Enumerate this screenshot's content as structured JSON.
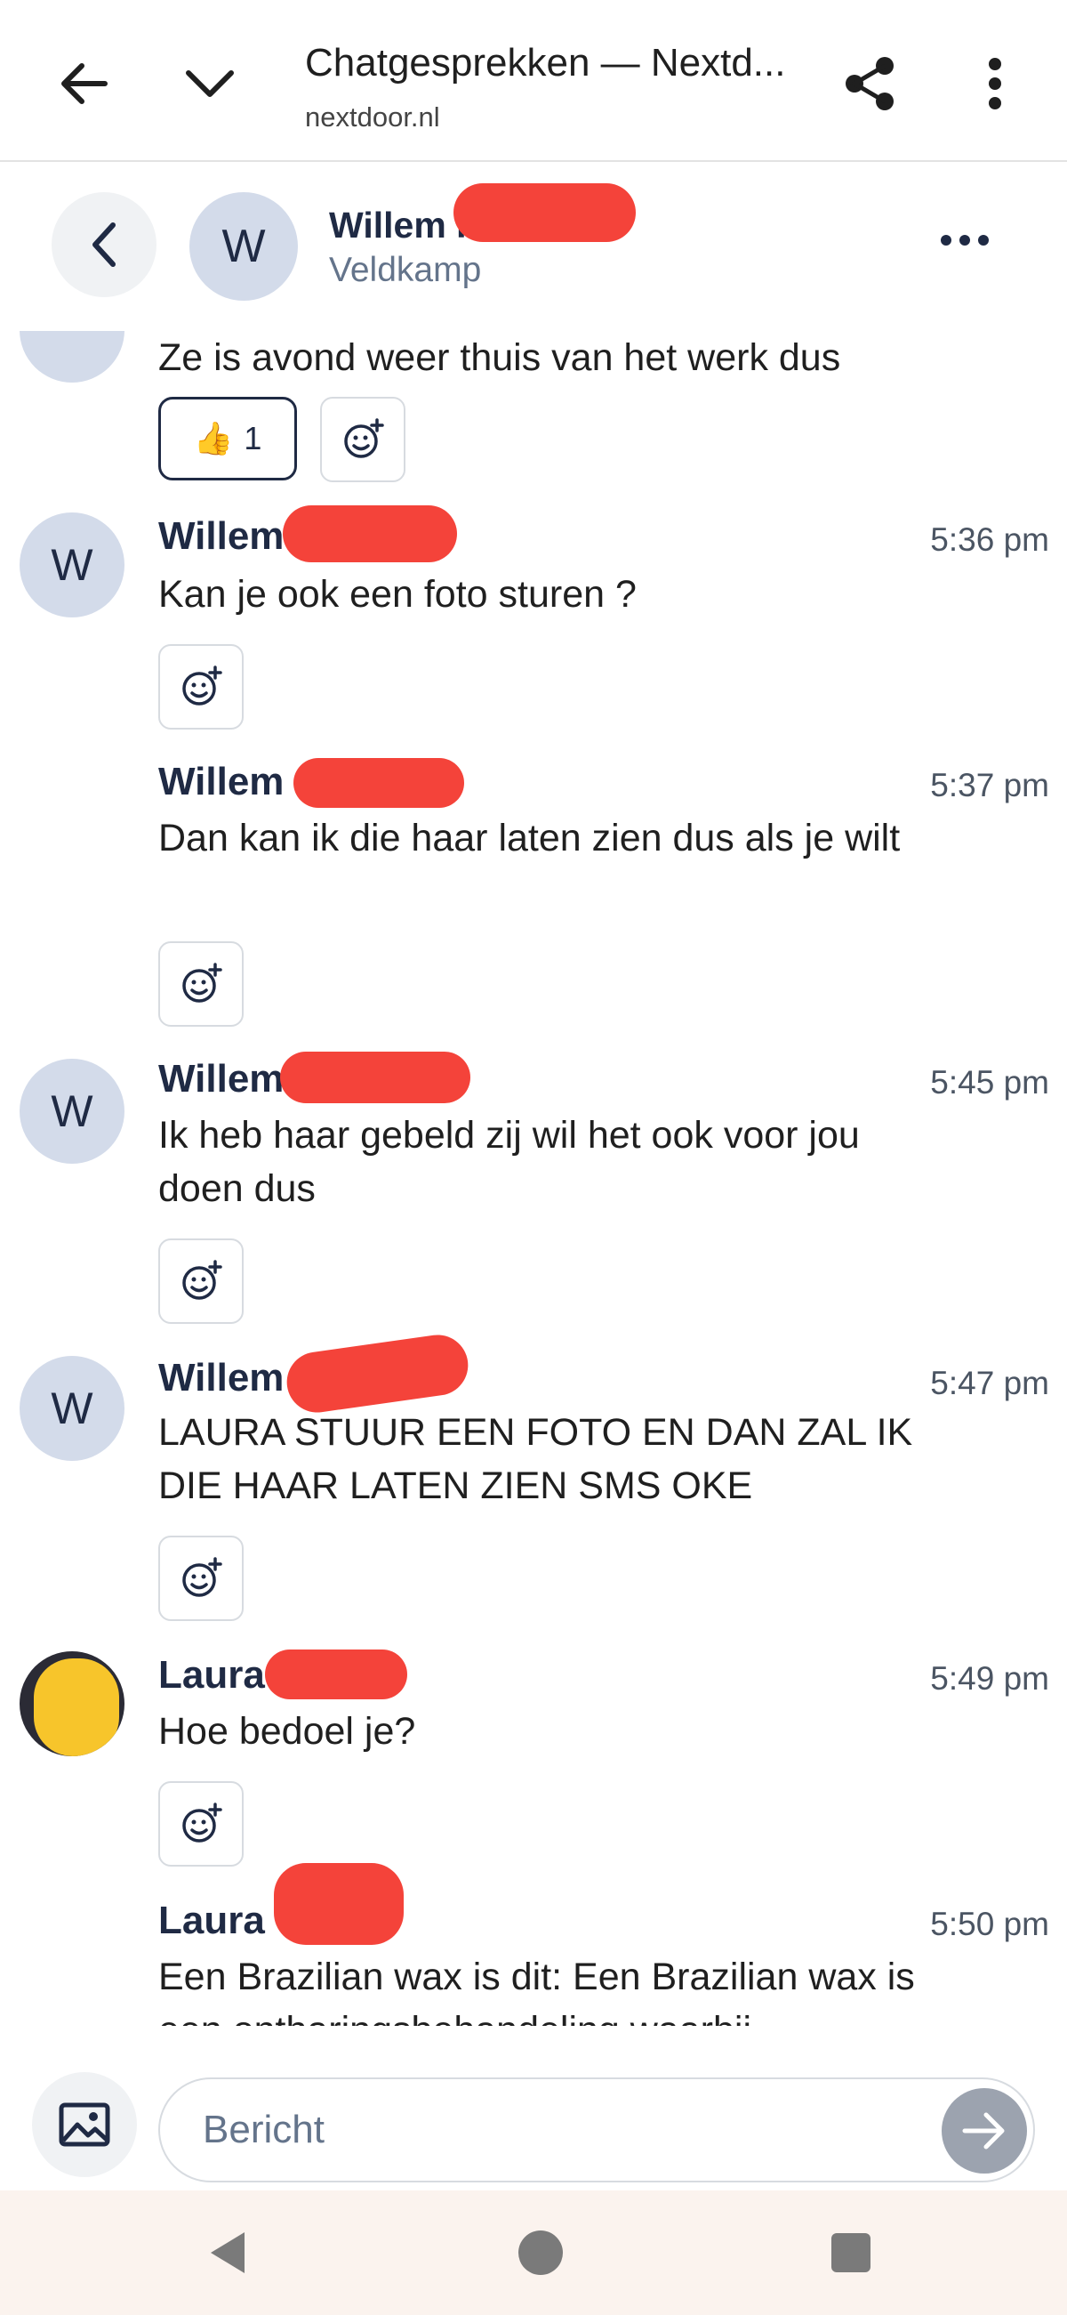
{
  "browser": {
    "title": "Chatgesprekken — Nextd...",
    "url": "nextdoor.nl"
  },
  "header": {
    "name": "Willem F",
    "subtitle": "Veldkamp",
    "avatar_initial": "W"
  },
  "messages": [
    {
      "sender": "",
      "time": "",
      "text": "Ze is avond weer thuis van het werk dus",
      "reaction": {
        "emoji": "👍",
        "count": "1"
      }
    },
    {
      "sender": "Willem",
      "time": "5:36 pm",
      "text": "Kan je ook een foto sturen ?",
      "avatar_initial": "W"
    },
    {
      "sender": "Willem",
      "time": "5:37 pm",
      "text": "Dan kan ik die haar laten zien dus als je wilt"
    },
    {
      "sender": "Willem",
      "time": "5:45 pm",
      "text": "Ik heb haar gebeld zij wil het ook voor jou doen dus",
      "avatar_initial": "W"
    },
    {
      "sender": "Willem",
      "time": "5:47 pm",
      "text": "LAURA STUUR EEN FOTO EN DAN ZAL IK DIE HAAR LATEN ZIEN SMS OKE",
      "avatar_initial": "W"
    },
    {
      "sender": "Laura",
      "time": "5:49 pm",
      "text": "Hoe bedoel je?"
    },
    {
      "sender": "Laura",
      "time": "5:50 pm",
      "text": "Een Brazilian wax is dit: Een Brazilian wax is een ontharingsbehandeling waarbij"
    }
  ],
  "composer": {
    "placeholder": "Bericht"
  },
  "colors": {
    "redaction": "#f4433a",
    "avatar_bg": "#d3dbea",
    "name_text": "#1f2a44",
    "send_button": "#9ca3af",
    "nav_bar_bg": "#fbf3ee"
  },
  "icons": [
    "back-arrow-icon",
    "chevron-down-icon",
    "share-icon",
    "overflow-menu-icon",
    "chevron-left-icon",
    "more-horizontal-icon",
    "add-reaction-icon",
    "thumbs-up-icon",
    "image-icon",
    "send-arrow-icon",
    "nav-back-icon",
    "nav-home-icon",
    "nav-recents-icon"
  ]
}
